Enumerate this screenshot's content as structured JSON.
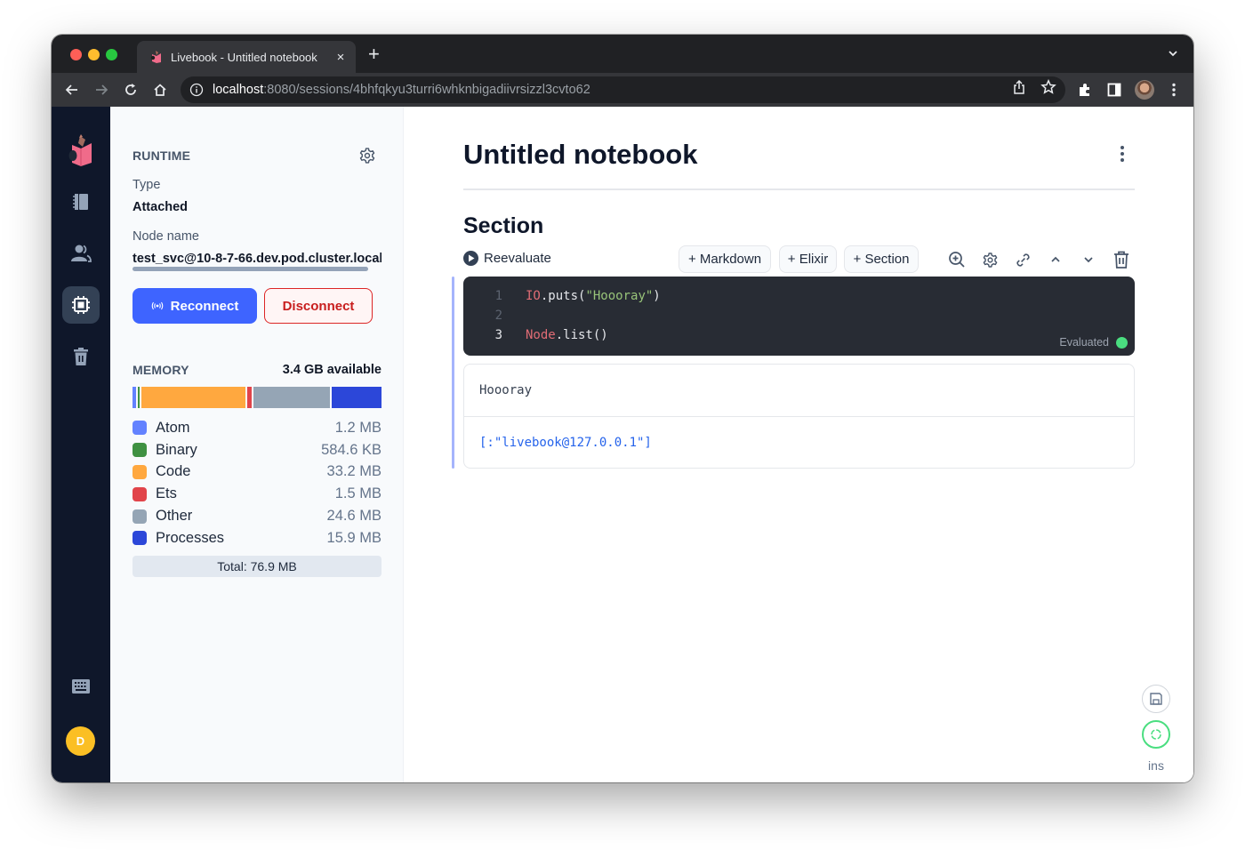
{
  "browser": {
    "tab_title": "Livebook - Untitled notebook",
    "tab_close": "×",
    "new_tab": "+",
    "url_host": "localhost",
    "url_path": ":8080/sessions/4bhfqkyu3turri6whknbigadiivrsizzl3cvto62",
    "icons": [
      "back-icon",
      "forward-icon",
      "reload-icon",
      "home-icon",
      "info-icon",
      "share-icon",
      "bookmark-star-icon",
      "extensions-icon",
      "side-panel-icon",
      "profile-avatar",
      "menu-icon",
      "tab-list-chevron-icon"
    ]
  },
  "rail": {
    "items": [
      {
        "name": "livebook-logo"
      },
      {
        "name": "notebook-outline-icon"
      },
      {
        "name": "users-icon"
      },
      {
        "name": "runtime-cpu-icon",
        "active": true
      },
      {
        "name": "bin-icon"
      },
      {
        "name": "keyboard-shortcuts-icon"
      }
    ],
    "user_initial": "D",
    "user_color": "#fbbf24"
  },
  "runtime": {
    "heading": "RUNTIME",
    "type_label": "Type",
    "type_value": "Attached",
    "node_label": "Node name",
    "node_value": "test_svc@10-8-7-66.dev.pod.cluster.local",
    "reconnect_label": "Reconnect",
    "disconnect_label": "Disconnect"
  },
  "memory": {
    "heading": "MEMORY",
    "available": "3.4 GB available",
    "items": [
      {
        "name": "Atom",
        "value": "1.2 MB",
        "mb": 1.2,
        "color": "#6382ff"
      },
      {
        "name": "Binary",
        "value": "584.6 KB",
        "mb": 0.57,
        "color": "#3f9142"
      },
      {
        "name": "Code",
        "value": "33.2 MB",
        "mb": 33.2,
        "color": "#ffa83f"
      },
      {
        "name": "Ets",
        "value": "1.5 MB",
        "mb": 1.5,
        "color": "#e1444a"
      },
      {
        "name": "Other",
        "value": "24.6 MB",
        "mb": 24.6,
        "color": "#95a5b5"
      },
      {
        "name": "Processes",
        "value": "15.9 MB",
        "mb": 15.9,
        "color": "#2c47d9"
      }
    ],
    "total": "Total: 76.9 MB"
  },
  "notebook": {
    "title": "Untitled notebook",
    "section_title": "Section",
    "reevaluate_label": "Reevaluate",
    "add_markdown": "+ Markdown",
    "add_elixir": "+ Elixir",
    "add_section": "+ Section",
    "cell_actions": [
      "zoom-in-icon",
      "settings-gear-icon",
      "link-icon",
      "chevron-up-icon",
      "chevron-down-icon",
      "delete-trash-icon"
    ],
    "code_lines": [
      {
        "n": "1",
        "tokens": [
          {
            "t": "IO",
            "c": "mod"
          },
          {
            "t": ".puts(",
            "c": "punc"
          },
          {
            "t": "\"Hoooray\"",
            "c": "str"
          },
          {
            "t": ")",
            "c": "punc"
          }
        ]
      },
      {
        "n": "2",
        "tokens": []
      },
      {
        "n": "3",
        "tokens": [
          {
            "t": "Node",
            "c": "mod"
          },
          {
            "t": ".list()",
            "c": "punc"
          }
        ]
      }
    ],
    "status": "Evaluated",
    "status_color": "#4ade80",
    "outputs": {
      "stdout": "Hoooray",
      "result": "[:\"livebook@127.0.0.1\"]"
    }
  },
  "floating": {
    "mode_indicator": "ins"
  }
}
